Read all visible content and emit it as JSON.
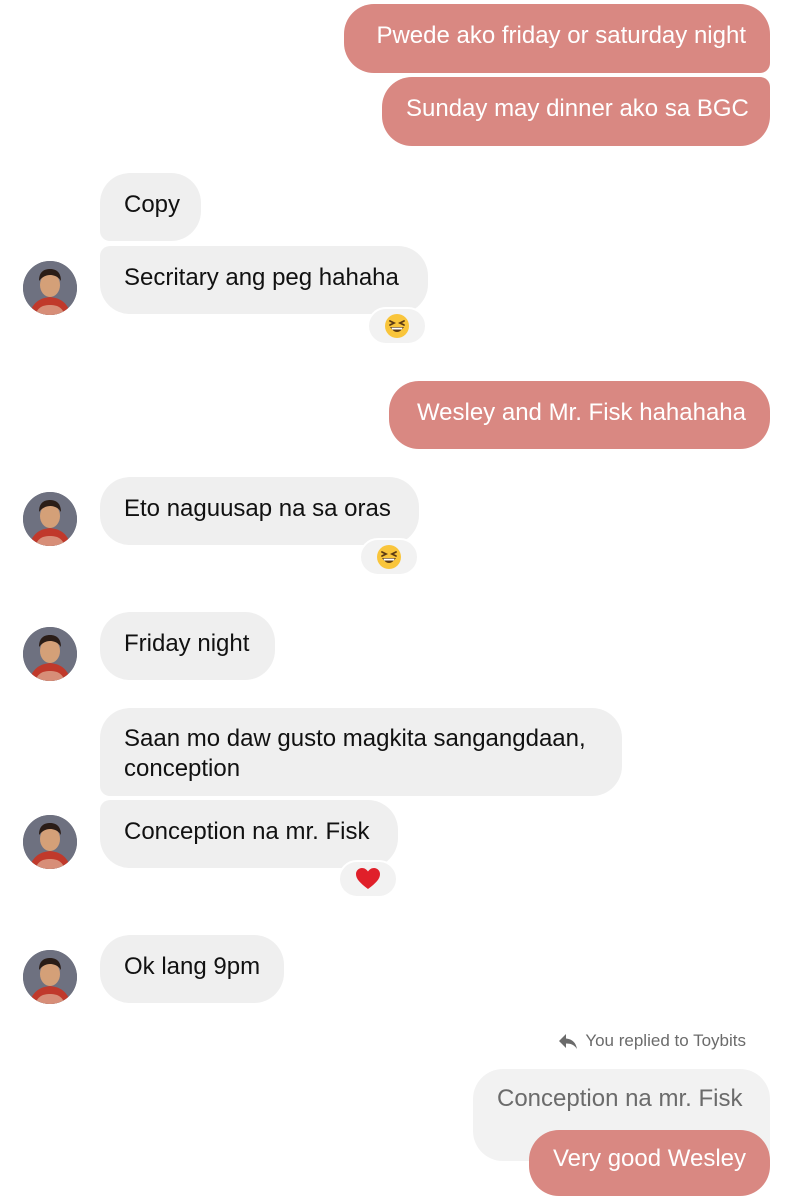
{
  "contact": {
    "name": "Toybits"
  },
  "messages": [
    {
      "id": "m1",
      "direction": "outgoing",
      "text": "Pwede ako friday or saturday night"
    },
    {
      "id": "m2",
      "direction": "outgoing",
      "text": "Sunday may dinner ako sa BGC"
    },
    {
      "id": "m3",
      "direction": "incoming",
      "text": "Copy"
    },
    {
      "id": "m4",
      "direction": "incoming",
      "text": "Secritary ang peg hahaha",
      "reaction": "grinning-squinting-face-emoji"
    },
    {
      "id": "m5",
      "direction": "outgoing",
      "text": "Wesley and Mr. Fisk hahahaha"
    },
    {
      "id": "m6",
      "direction": "incoming",
      "text": "Eto naguusap na sa oras",
      "reaction": "grinning-squinting-face-emoji"
    },
    {
      "id": "m7",
      "direction": "incoming",
      "text": "Friday night"
    },
    {
      "id": "m8",
      "direction": "incoming",
      "text_line1": "Saan mo daw gusto magkita sangangdaan,",
      "text_line2": "conception"
    },
    {
      "id": "m9",
      "direction": "incoming",
      "text": "Conception na mr. Fisk",
      "reaction": "red-heart-emoji"
    },
    {
      "id": "m10",
      "direction": "incoming",
      "text": "Ok lang 9pm"
    },
    {
      "id": "m11",
      "direction": "outgoing",
      "text": "Very good Wesley",
      "reply_label": "You replied to Toybits",
      "quoted_text": "Conception na mr. Fisk"
    }
  ],
  "colors": {
    "outgoing_bubble": "#d98882",
    "incoming_bubble": "#efefef",
    "reaction_bg": "#f2f2f2",
    "muted_text": "#6b6b6b"
  }
}
